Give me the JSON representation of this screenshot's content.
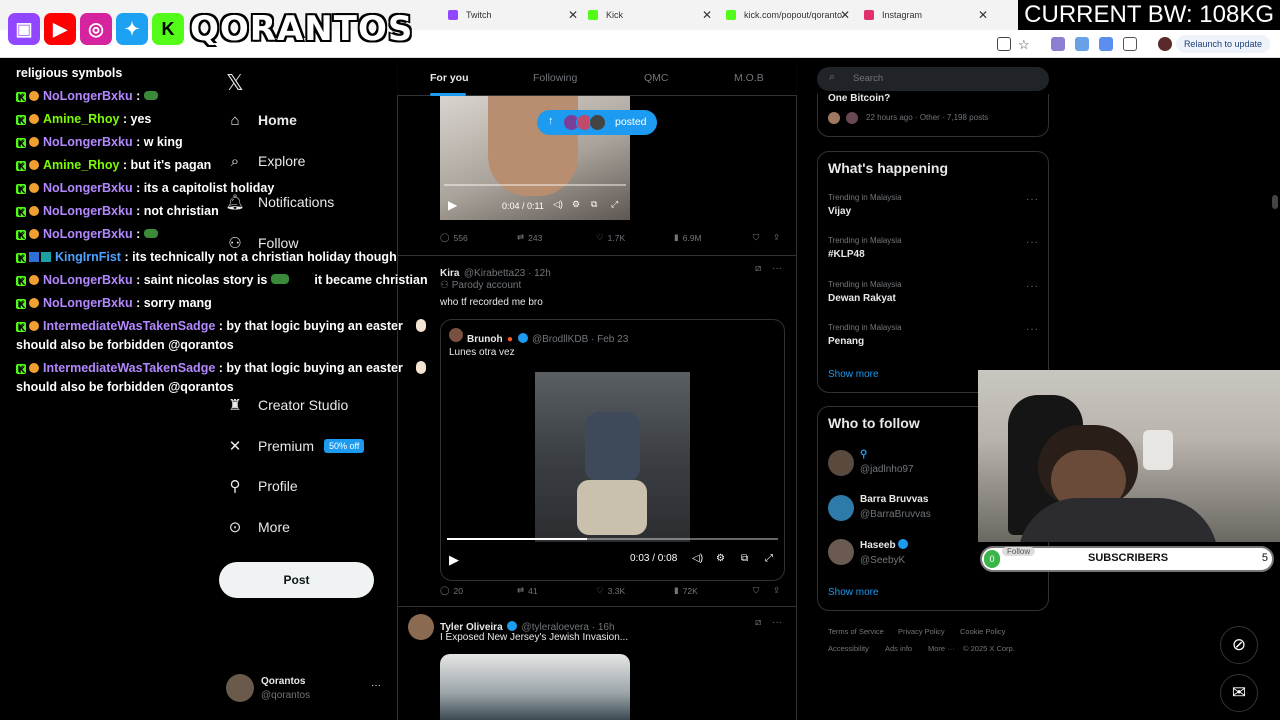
{
  "browser": {
    "tabs": [
      {
        "label": "Twitch",
        "icon": "twitch-icon",
        "color": "#9146ff"
      },
      {
        "label": "Kick",
        "icon": "kick-icon",
        "color": "#53fc18"
      },
      {
        "label": "kick.com/popout/qoranto",
        "icon": "kick-icon",
        "color": "#53fc18"
      },
      {
        "label": "Instagram",
        "icon": "instagram-icon",
        "color": "#e1306c"
      }
    ],
    "relaunch": "Relaunch to update"
  },
  "overlay": {
    "brand": "QORANTOS",
    "bandwidth": "CURRENT BW: 108KG"
  },
  "chat": [
    {
      "user": "",
      "message": "religious symbols",
      "color": "#ffffff"
    },
    {
      "user": "NoLongerBxku",
      "message": ":",
      "color": "#b388ff"
    },
    {
      "user": "Amine_Rhoy",
      "message": ": yes",
      "color": "#7CFC00"
    },
    {
      "user": "NoLongerBxku",
      "message": ": w king",
      "color": "#b388ff"
    },
    {
      "user": "Amine_Rhoy",
      "message": ": but it's pagan",
      "color": "#7CFC00"
    },
    {
      "user": "NoLongerBxku",
      "message": ": its a capitolist holiday",
      "color": "#b388ff"
    },
    {
      "user": "NoLongerBxku",
      "message": ": not christian",
      "color": "#b388ff"
    },
    {
      "user": "NoLongerBxku",
      "message": ":",
      "color": "#b388ff"
    },
    {
      "user": "KingIrnFist",
      "message": ": its technically not a christian holiday though",
      "color": "#4aa3ff"
    },
    {
      "user": "NoLongerBxku",
      "message": ": saint nicolas story is",
      "color": "#b388ff"
    },
    {
      "user": "NoLongerBxku",
      "message": ": sorry mang",
      "color": "#b388ff"
    },
    {
      "user": "IntermediateWasTakenSadge",
      "message": ": by that logic buying an easter",
      "color": "#b388ff"
    },
    {
      "user": "",
      "message": "should also be forbidden @qorantos",
      "color": "#ffffff"
    },
    {
      "user": "IntermediateWasTakenSadge",
      "message": ": by that logic buying an easter",
      "color": "#b388ff"
    },
    {
      "user": "",
      "message": "should also be forbidden @qorantos",
      "color": "#ffffff"
    }
  ],
  "chat_extra": "it became christian",
  "nav": {
    "items": [
      {
        "label": "Home",
        "icon": "home-icon"
      },
      {
        "label": "Explore",
        "icon": "search-icon"
      },
      {
        "label": "Notifications",
        "icon": "bell-icon"
      },
      {
        "label": "Follow",
        "icon": "follow-icon"
      },
      {
        "label": "Creator Studio",
        "icon": "creator-studio-icon"
      },
      {
        "label": "Premium",
        "icon": "x-icon"
      },
      {
        "label": "Profile",
        "icon": "profile-icon"
      },
      {
        "label": "More",
        "icon": "more-icon"
      }
    ],
    "premium_badge": "50% off",
    "post": "Post",
    "account_name": "Qorantos",
    "account_handle": "@qorantos"
  },
  "timeline": {
    "tabs": [
      "For you",
      "Following",
      "QMC",
      "M.O.B"
    ],
    "posted_label": "posted",
    "tweet1": {
      "time": "0:04 / 0:11",
      "replies": "556",
      "reposts": "243",
      "likes": "1.7K",
      "views": "6.9M"
    },
    "tweet2": {
      "name": "Kira",
      "handle": "@Kirabetta23 · 12h",
      "label": "Parody account",
      "text": "who tf recorded me bro",
      "quote_name": "Brunoh",
      "quote_handle": "@BrodllKDB · Feb 23",
      "quote_text": "Lunes otra vez",
      "time": "0:03 / 0:08",
      "replies": "20",
      "reposts": "41",
      "likes": "3.3K",
      "views": "72K"
    },
    "tweet3": {
      "name": "Tyler Oliveira",
      "handle": "@tyleraloevera · 16h",
      "text": "I Exposed New Jersey's Jewish Invasion..."
    }
  },
  "right": {
    "search_placeholder": "Search",
    "top_card": {
      "title": "One Bitcoin?",
      "meta": "22 hours ago · Other · 7,198 posts"
    },
    "happening_title": "What's happening",
    "trends": [
      {
        "meta": "Trending in Malaysia",
        "name": "Vijay"
      },
      {
        "meta": "Trending in Malaysia",
        "name": "#KLP48"
      },
      {
        "meta": "Trending in Malaysia",
        "name": "Dewan Rakyat"
      },
      {
        "meta": "Trending in Malaysia",
        "name": "Penang"
      }
    ],
    "show_more": "Show more",
    "wtf_title": "Who to follow",
    "wtf": [
      {
        "name": "",
        "handle": "@jadlnho97"
      },
      {
        "name": "Barra Bruvvas",
        "handle": "@BarraBruvvas"
      },
      {
        "name": "Haseeb",
        "handle": "@SeebyK"
      }
    ],
    "footer": [
      "Terms of Service",
      "Privacy Policy",
      "Cookie Policy",
      "Accessibility",
      "Ads info",
      "More ···",
      "© 2025 X Corp."
    ]
  },
  "webcam": {
    "follow": "Follow",
    "subs_label": "SUBSCRIBERS",
    "subs_left": "0",
    "subs_right": "5"
  }
}
